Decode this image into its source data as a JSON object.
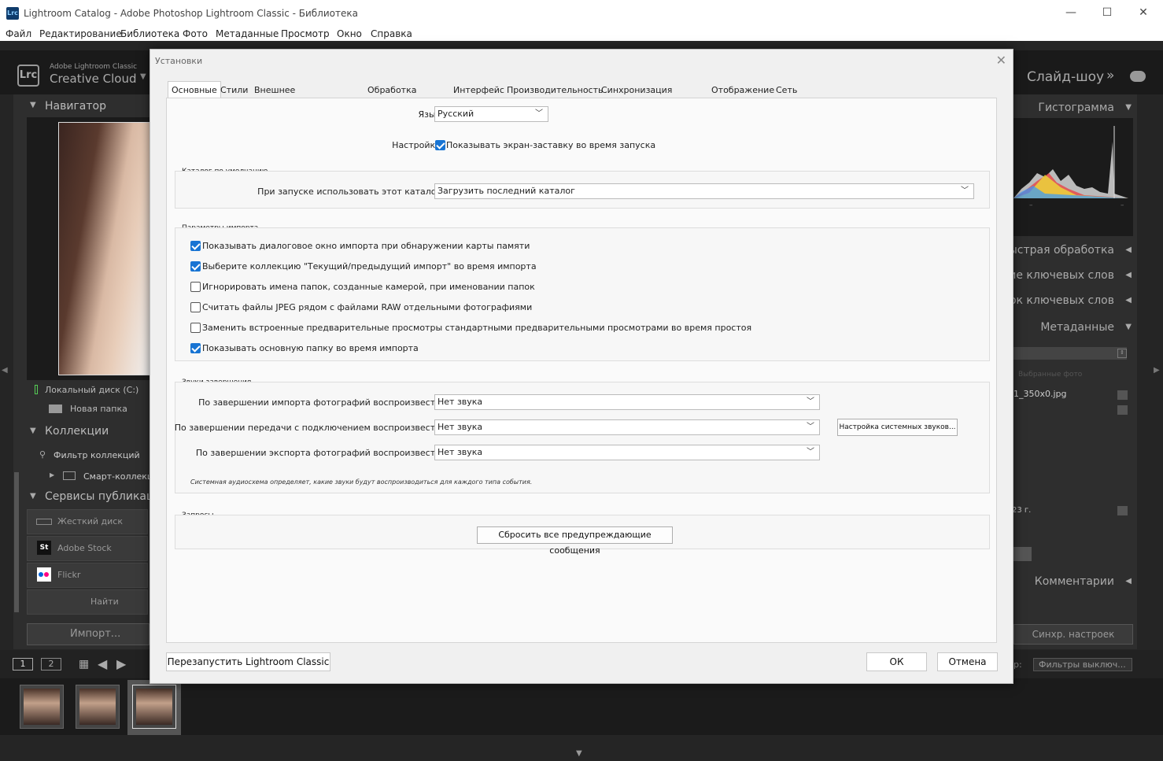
{
  "window": {
    "app_icon": "Lrc",
    "title": "Lightroom Catalog - Adobe Photoshop Lightroom Classic - Библиотека",
    "controls": {
      "minimize": "—",
      "maximize": "☐",
      "close": "✕"
    }
  },
  "menu": [
    "Файл",
    "Редактирование",
    "Библиотека",
    "Фото",
    "Метаданные",
    "Просмотр",
    "Окно",
    "Справка"
  ],
  "lr": {
    "logo": "Lrc",
    "brand_top": "Adobe Lightroom Classic",
    "brand_bottom": "Creative Cloud",
    "module_slideshow": "Слайд-шоу",
    "left": {
      "navigator": "Навигатор",
      "local_disk": "Локальный диск (C:)",
      "new_folder": "Новая папка",
      "collections": "Коллекции",
      "filter_collections": "Фильтр коллекций",
      "smart_collections": "Смарт-коллекци",
      "publish_services": "Сервисы публикаци",
      "hard_disk": "Жесткий диск",
      "adobe_stock": "Adobe Stock",
      "flickr": "Flickr",
      "find_others": "Найти други",
      "import_button": "Импорт..."
    },
    "right": {
      "histogram": "Гистограмма",
      "quick_develop": "Быстрая обработка",
      "keywording": "ие ключевых слов",
      "keyword_list": "сок ключевых слов",
      "metadata": "Метаданные",
      "selected_photo": "Выбранные фото",
      "filename": "1_350x0.jpg",
      "date_fragment": "23 г.",
      "comments": "Комментарии",
      "sync_settings": "Синхр. настроек",
      "filter_label": "р:",
      "filter_value": "Фильтры выключ..."
    },
    "filmstrip": {
      "view1": "1",
      "view2": "2"
    }
  },
  "dialog": {
    "title": "Установки",
    "tabs": [
      "Основные",
      "Стили",
      "Внешнее редактирование",
      "Обработка файлов",
      "Интерфейс",
      "Производительность",
      "Синхронизация Lightroom",
      "Отображение",
      "Сеть"
    ],
    "language_label": "Язык:",
    "language_value": "Русский",
    "settings_label": "Настройки:",
    "splash_label": "Показывать экран-заставку во время запуска",
    "splash_checked": true,
    "catalog_group": "Каталог по умолчанию",
    "catalog_label": "При запуске использовать этот каталог:",
    "catalog_value": "Загрузить последний каталог",
    "import_group": "Параметры импорта",
    "import_options": [
      {
        "label": "Показывать диалоговое окно импорта при обнаружении карты памяти",
        "checked": true
      },
      {
        "label": "Выберите коллекцию \"Текущий/предыдущий импорт\" во время импорта",
        "checked": true
      },
      {
        "label": "Игнорировать имена папок, созданные камерой, при именовании папок",
        "checked": false
      },
      {
        "label": "Считать файлы JPEG рядом с файлами RAW отдельными фотографиями",
        "checked": false
      },
      {
        "label": "Заменить встроенные предварительные просмотры стандартными предварительными просмотрами во время простоя",
        "checked": false
      },
      {
        "label": "Показывать основную папку во время импорта",
        "checked": true
      }
    ],
    "sounds_group": "Звуки завершения",
    "sound_import_label": "По завершении импорта фотографий воспроизвести:",
    "sound_import_value": "Нет звука",
    "sound_tether_label": "По завершении передачи с подключением воспроизвести:",
    "sound_tether_value": "Нет звука",
    "sound_export_label": "По завершении экспорта фотографий воспроизвести:",
    "sound_export_value": "Нет звука",
    "system_sounds_button": "Настройка системных звуков...",
    "sounds_note": "Системная аудиосхема определяет, какие звуки будут воспроизводиться для каждого типа события.",
    "prompts_group": "Запросы",
    "reset_warnings_button": "Сбросить все предупреждающие сообщения",
    "restart_button": "Перезапустить Lightroom Classic",
    "ok_button": "ОК",
    "cancel_button": "Отмена"
  }
}
